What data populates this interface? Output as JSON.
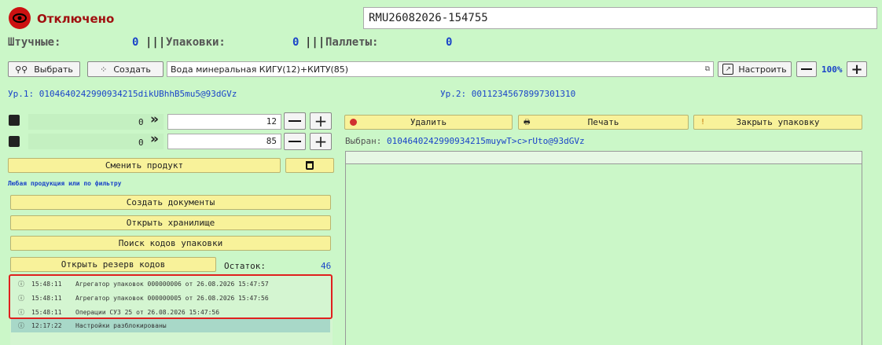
{
  "status": {
    "label": "Отключено",
    "color": "#cc1111"
  },
  "session_id": "RMU26082026-154755",
  "counters": {
    "pieces_label": "Штучные:",
    "pieces_value": "0",
    "sep1": "|||",
    "boxes_label": "Упаковки:",
    "boxes_value": "0",
    "sep2": "|||",
    "pallets_label": "Паллеты:",
    "pallets_value": "0"
  },
  "toolbar": {
    "select_label": "Выбрать",
    "create_label": "Создать",
    "product_name": "Вода минеральная КИГУ(12)+КИТУ(85)",
    "configure_label": "Настроить",
    "zoom": "100%"
  },
  "levels": {
    "l1_label": "Ур.1:",
    "l1_value": "0104640242990934215dikUBhhB5mu5@93dGVz",
    "l2_label": "Ур.2:",
    "l2_value": "00112345678997301310"
  },
  "rows": [
    {
      "count": "0",
      "quantity": "12"
    },
    {
      "count": "0",
      "quantity": "85"
    }
  ],
  "actions": {
    "delete_label": "Удалить",
    "print_label": "Печать",
    "close_box_label": "Закрыть упаковку",
    "selected_label": "Выбран:",
    "selected_value": "0104640242990934215muywT>c>rUto@93dGVz"
  },
  "left_panel": {
    "change_product_label": "Сменить продукт",
    "filter_text": "Любая продукция или по фильтру",
    "create_docs_label": "Создать документы",
    "open_storage_label": "Открыть хранилище",
    "search_codes_label": "Поиск кодов упаковки",
    "open_reserve_label": "Открыть резерв кодов",
    "remainder_label": "Остаток:",
    "remainder_value": "46"
  },
  "log": [
    {
      "time": "15:48:11",
      "text": "Агрегатор упаковок 000000006 от 26.08.2026 15:47:57"
    },
    {
      "time": "15:48:11",
      "text": "Агрегатор упаковок 000000005 от 26.08.2026 15:47:56"
    },
    {
      "time": "15:48:11",
      "text": "Операции СУЗ 25 от 26.08.2026 15:47:56"
    },
    {
      "time": "12:17:22",
      "text": "Настройки разблокированы"
    }
  ],
  "colors": {
    "background": "#cbf7c8",
    "button": "#f8f29a",
    "accent_blue": "#1a44c8",
    "highlight": "#e0201e"
  }
}
